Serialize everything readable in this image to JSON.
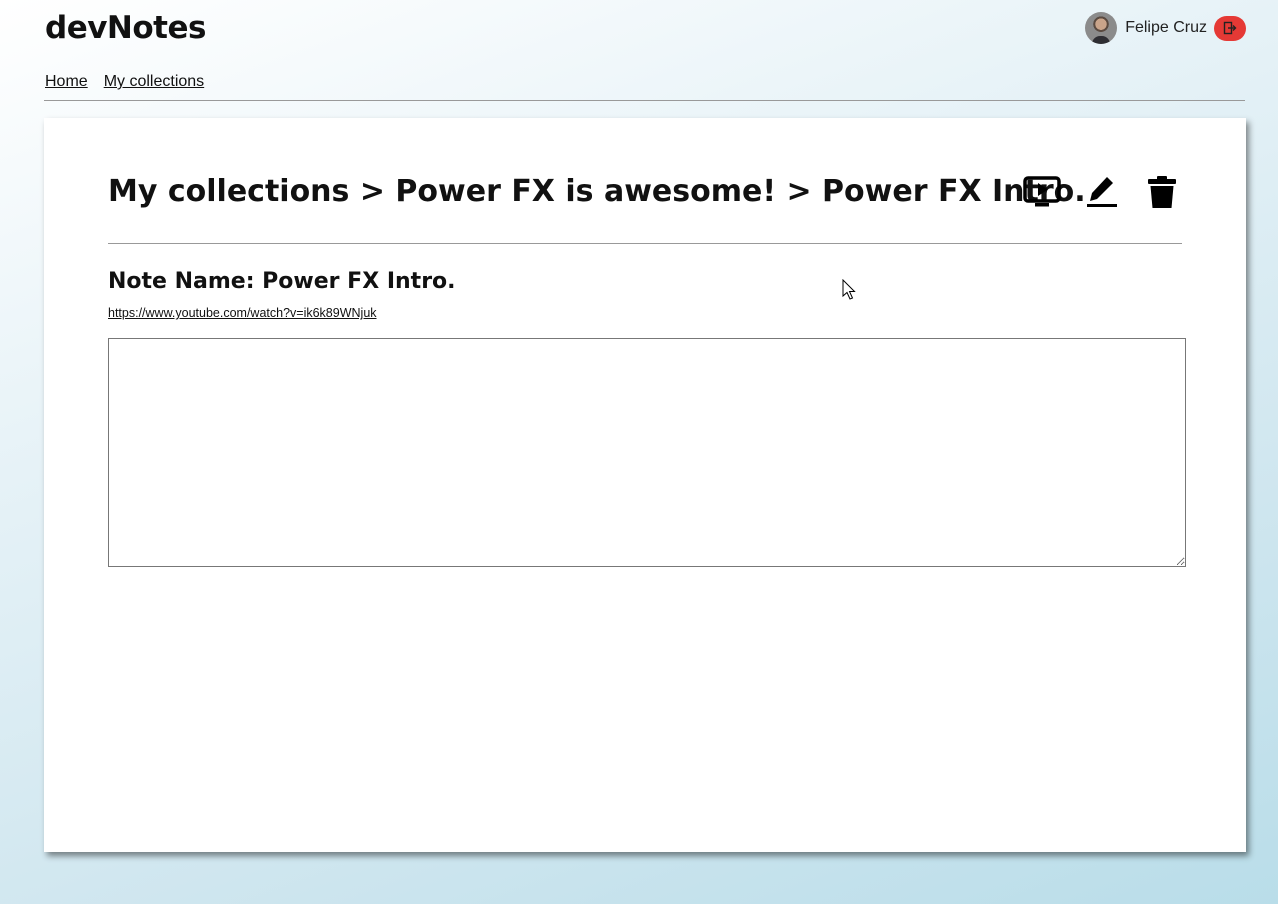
{
  "app": {
    "brand": "devNotes"
  },
  "user": {
    "name": "Felipe Cruz",
    "avatar_icon": "user-avatar",
    "logout_icon": "logout-icon",
    "logout_color": "#e53935"
  },
  "nav": {
    "items": [
      {
        "label": "Home"
      },
      {
        "label": "My collections"
      }
    ]
  },
  "page": {
    "breadcrumb": "My collections > Power FX is awesome! > Power FX Intro.",
    "actions": [
      {
        "name": "play-video",
        "icon": "monitor-play-icon"
      },
      {
        "name": "edit",
        "icon": "pencil-icon"
      },
      {
        "name": "delete",
        "icon": "trash-icon"
      }
    ],
    "note_name": "Note Name: Power FX Intro.",
    "note_url": "https://www.youtube.com/watch?v=ik6k89WNjuk",
    "note_text": "",
    "note_placeholder": ""
  }
}
